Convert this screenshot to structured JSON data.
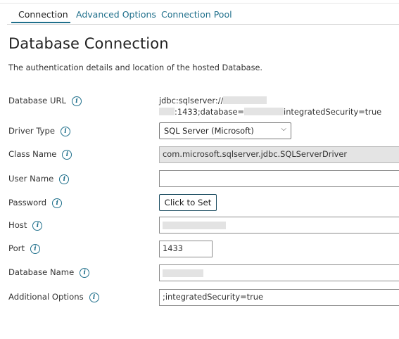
{
  "tabs": [
    {
      "label": "Connection",
      "active": true
    },
    {
      "label": "Advanced Options",
      "active": false
    },
    {
      "label": "Connection Pool",
      "active": false
    }
  ],
  "page": {
    "title": "Database Connection",
    "description": "The authentication details and location of the hosted Database."
  },
  "fields": {
    "database_url": {
      "label": "Database URL",
      "value_line1": "jdbc:sqlserver://",
      "value_line2_part1": ":1433;database=",
      "value_line2_part2": "integratedSecurity=true"
    },
    "driver_type": {
      "label": "Driver Type",
      "value": "SQL Server (Microsoft)"
    },
    "class_name": {
      "label": "Class Name",
      "value": "com.microsoft.sqlserver.jdbc.SQLServerDriver"
    },
    "user_name": {
      "label": "User Name",
      "value": ""
    },
    "password": {
      "label": "Password",
      "button": "Click to Set"
    },
    "host": {
      "label": "Host",
      "value": ""
    },
    "port": {
      "label": "Port",
      "value": "1433"
    },
    "database_name": {
      "label": "Database Name",
      "value": ""
    },
    "additional_options": {
      "label": "Additional Options",
      "value": ";integratedSecurity=true"
    }
  },
  "colors": {
    "accent": "#1f6f8b",
    "readonly_bg": "#e4e4e4"
  },
  "icons": {
    "info": "info-icon",
    "dropdown": "chevron-down-icon"
  }
}
